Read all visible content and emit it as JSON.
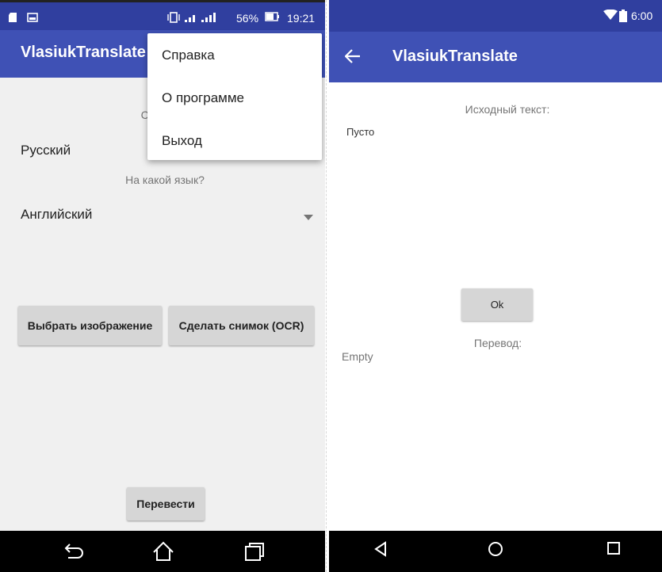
{
  "left_screen": {
    "status": {
      "battery_percent": "56%",
      "time": "19:21"
    },
    "app_title": "VlasiukTranslate",
    "overflow_menu": {
      "items": [
        "Справка",
        "О программе",
        "Выход"
      ]
    },
    "from_language_prompt": "С какого языка?",
    "from_language_value": "Русский",
    "to_language_prompt": "На какой язык?",
    "to_language_value": "Английский",
    "pick_image_button": "Выбрать изображение",
    "take_photo_button": "Сделать снимок (OCR)",
    "translate_button": "Перевести",
    "icons": {
      "back": "back-icon",
      "home": "home-icon",
      "recents": "recents-icon"
    }
  },
  "right_screen": {
    "status": {
      "time": "6:00"
    },
    "app_title": "VlasiukTranslate",
    "source_label": "Исходный текст:",
    "source_text": "Пусто",
    "ok_button": "Ok",
    "translation_label": "Перевод:",
    "translation_text": "Empty",
    "icons": {
      "up": "arrow-left-icon",
      "back": "triangle-back-icon",
      "home": "circle-home-icon",
      "recents": "square-recents-icon"
    }
  },
  "colors": {
    "primary": "#3f51b5",
    "primary_dark": "#303f9f",
    "background": "#f0f0f0",
    "button": "#d6d6d6"
  }
}
